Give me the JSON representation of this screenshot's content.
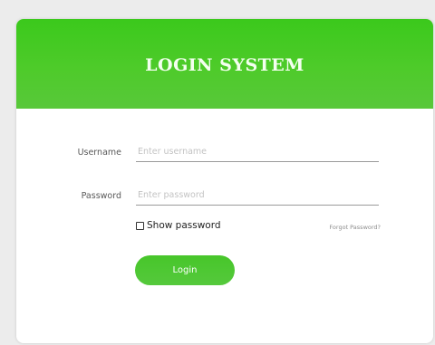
{
  "header": {
    "title": "LOGIN SYSTEM"
  },
  "form": {
    "username": {
      "label": "Username",
      "placeholder": "Enter username",
      "value": ""
    },
    "password": {
      "label": "Password",
      "placeholder": "Enter password",
      "value": ""
    },
    "show_password": {
      "label": "Show password",
      "checked": false
    },
    "forgot_password_label": "Forgot Password?",
    "login_label": "Login"
  },
  "colors": {
    "accent": "#4ecb2a",
    "background": "#ececec",
    "card": "#ffffff"
  }
}
